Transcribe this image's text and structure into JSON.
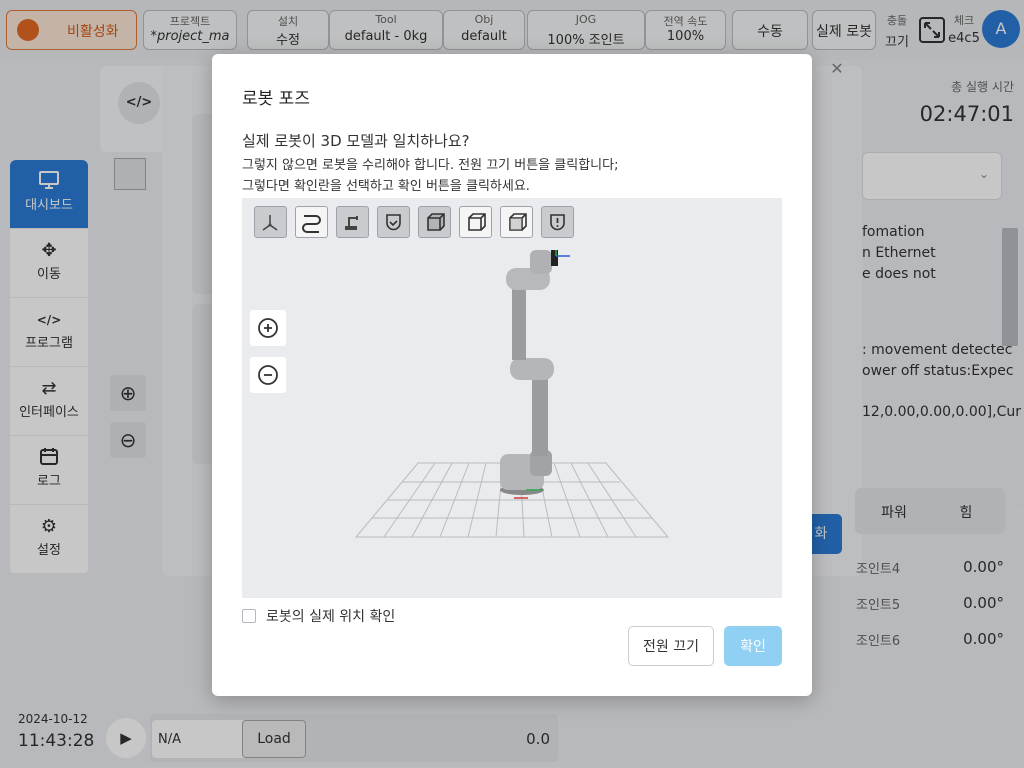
{
  "topbar": {
    "activate_label": "비활성화",
    "project": {
      "caption": "프로젝트",
      "value": "*project_ma"
    },
    "install": {
      "caption": "설치",
      "value": "수정"
    },
    "tool": {
      "caption": "Tool",
      "value": "default - 0kg"
    },
    "obj": {
      "caption": "Obj",
      "value": "default"
    },
    "jog": {
      "caption": "JOG",
      "value": "100% 조인트"
    },
    "speed": {
      "caption": "전역 속도",
      "value": "100%"
    },
    "manual_label": "수동",
    "real_robot_label": "실제 로봇",
    "collision": {
      "caption": "충돌",
      "value": "끄기"
    },
    "check": {
      "caption": "체크",
      "value": "e4c5"
    },
    "avatar_letter": "A"
  },
  "sidenav": {
    "items": [
      {
        "label": "대시보드",
        "icon": "monitor-icon"
      },
      {
        "label": "이동",
        "icon": "move-icon"
      },
      {
        "label": "프로그램",
        "icon": "code-icon"
      },
      {
        "label": "인터페이스",
        "icon": "swap-icon"
      },
      {
        "label": "로그",
        "icon": "calendar-icon"
      },
      {
        "label": "설정",
        "icon": "gear-icon"
      }
    ]
  },
  "background": {
    "total_runtime_label": "총 실행 시간",
    "total_runtime_value": "02:47:01",
    "log_lines": [
      "fomation",
      "n Ethernet",
      "e does not",
      ": movement detectec",
      "ower off status:Expec",
      "12,0.00,0.00,0.00],Cur"
    ],
    "tabs": [
      "파워",
      "힘"
    ],
    "joints": [
      {
        "name": "조인트4",
        "value": "0.00°"
      },
      {
        "name": "조인트5",
        "value": "0.00°"
      },
      {
        "name": "조인트6",
        "value": "0.00°"
      }
    ],
    "date": "2024-10-12",
    "time": "11:43:28",
    "na_label": "N/A",
    "load_label": "Load",
    "progress_value": "0.0",
    "sync_label": "화"
  },
  "modal": {
    "title": "로봇 포즈",
    "question": "실제 로봇이 3D 모델과 일치하나요?",
    "line1": "그렇지 않으면 로봇을 수리해야 합니다. 전원 끄기 버튼을 클릭합니다;",
    "line2": "그렇다면 확인란을 선택하고 확인 버튼을 클릭하세요.",
    "checkbox_label": "로봇의 실제 위치 확인",
    "power_off_label": "전원 끄기",
    "confirm_label": "확인"
  }
}
